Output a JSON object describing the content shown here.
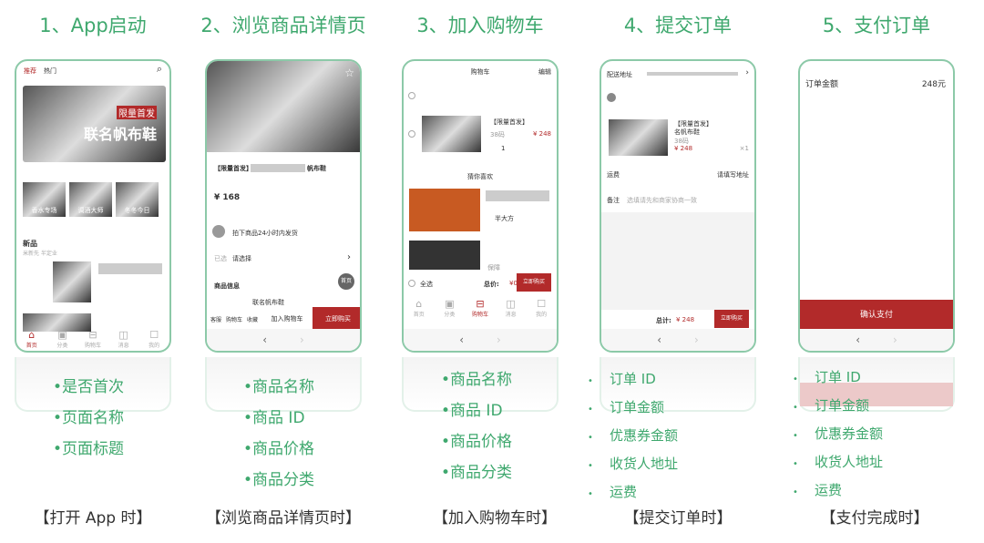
{
  "colors": {
    "accent": "#3fa86e",
    "brand_red": "#b22a2a"
  },
  "steps": [
    {
      "title": "1、App启动",
      "caption": "【打开 App 时】",
      "fields": [
        "•是否首次",
        "•页面名称",
        "•页面标题"
      ]
    },
    {
      "title": "2、浏览商品详情页",
      "caption": "【浏览商品详情页时】",
      "fields": [
        "•商品名称",
        "•商品 ID",
        "•商品价格",
        "•商品分类"
      ]
    },
    {
      "title": "3、加入购物车",
      "caption": "【加入购物车时】",
      "fields": [
        "•商品名称",
        "•商品 ID",
        "•商品价格",
        "•商品分类"
      ]
    },
    {
      "title": "4、提交订单",
      "caption": "【提交订单时】",
      "fields": [
        "订单 ID",
        "订单金额",
        "优惠券金额",
        "收货人地址",
        "运费"
      ]
    },
    {
      "title": "5、支付订单",
      "caption": "【支付完成时】",
      "fields": [
        "订单 ID",
        "订单金额",
        "优惠券金额",
        "收货人地址",
        "运费"
      ]
    }
  ],
  "home": {
    "tabs": [
      "推荐",
      "热门"
    ],
    "banner_tag": "限量首发",
    "banner_text": "联名帆布鞋",
    "categories": [
      "香水专场",
      "调酒大师",
      "冬冬今日"
    ],
    "section": "新品",
    "section_sub": "米新先  半定业",
    "nav": [
      "首页",
      "分类",
      "购物车",
      "消息",
      "我的"
    ]
  },
  "detail": {
    "title": "【限量首发】",
    "title_end": "帆布鞋",
    "price": "¥ 168",
    "notice": "拍下商品24小时内发货",
    "select_label": "已选",
    "select_value": "请选择",
    "info_title": "商品信息",
    "info_text": "联名帆布鞋",
    "home_badge": "首页",
    "icons": [
      "客服",
      "购物车",
      "收藏"
    ],
    "add_cart": "加入购物车",
    "buy_now": "立即购买"
  },
  "cart": {
    "title": "购物车",
    "edit": "编辑",
    "item_title": "【限量首发】",
    "item_spec": "38码",
    "item_price": "¥ 248",
    "qty": "1",
    "guess": "猜你喜欢",
    "shop": "半大方",
    "tag": "保障",
    "select_all": "全选",
    "total_label": "总价:",
    "total": "¥0",
    "checkout": "立即购买",
    "nav": [
      "首页",
      "分类",
      "购物车",
      "消息",
      "我的"
    ]
  },
  "order": {
    "address_label": "配送地址",
    "item_title": "【限量首发】",
    "item_title2": "名帆布鞋",
    "item_spec": "38码",
    "item_price": "¥ 248",
    "qty": "×1",
    "shipping": "运费",
    "shipping_value": "请填写地址",
    "remark": "备注",
    "remark_placeholder": "选填请先和商家协商一致",
    "total_label": "总计:",
    "total": "¥ 248",
    "submit": "立即购买"
  },
  "pay": {
    "amount_label": "订单金额",
    "amount": "248元",
    "confirm": "确认支付"
  },
  "browser_nav": {
    "back": "‹",
    "forward": "›"
  }
}
